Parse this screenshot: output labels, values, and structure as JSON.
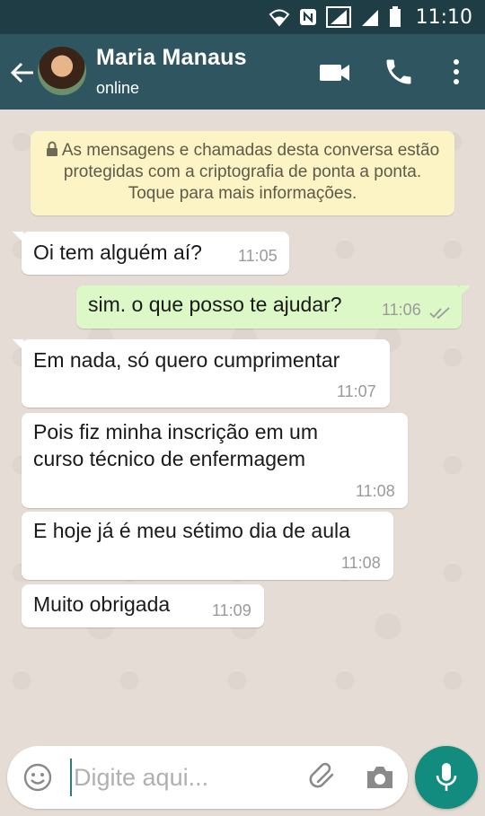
{
  "status_bar": {
    "time": "11:10",
    "icons": [
      "wifi-icon",
      "nfc-icon",
      "signal-icon",
      "signal-icon",
      "battery-icon"
    ]
  },
  "header": {
    "contact_name": "Maria Manaus",
    "contact_status": "online",
    "icons": [
      "back-arrow-icon",
      "video-call-icon",
      "phone-icon",
      "more-vert-icon"
    ]
  },
  "chat": {
    "encryption_notice": "As mensagens e chamadas desta conversa estão protegidas com a criptografia de ponta a ponta. Toque para mais informações.",
    "messages": [
      {
        "direction": "in",
        "text": "Oi tem alguém aí?",
        "time": "11:05"
      },
      {
        "direction": "out",
        "text": "sim. o que posso te ajudar?",
        "time": "11:06",
        "status": "read"
      },
      {
        "direction": "in",
        "text": "Em nada, só quero cumprimentar",
        "time": "11:07"
      },
      {
        "direction": "in",
        "text_lines": [
          "Pois fiz minha inscrição em um",
          "curso técnico de enfermagem"
        ],
        "time": "11:08"
      },
      {
        "direction": "in",
        "text": "E hoje já é meu sétimo dia de aula",
        "time": "11:08"
      },
      {
        "direction": "in",
        "text": "Muito obrigada",
        "time": "11:09"
      }
    ]
  },
  "input_bar": {
    "placeholder": "Digite aqui...",
    "value": "",
    "icons": [
      "emoji-icon",
      "attach-icon",
      "camera-icon",
      "mic-icon"
    ]
  },
  "colors": {
    "status_bar": "#1f3d45",
    "app_bar": "#2e5560",
    "chat_background": "#e5ddd5",
    "outgoing_bubble": "#dcf8c6",
    "incoming_bubble": "#ffffff",
    "notice_background": "#fcf4c4",
    "accent": "#128c7e",
    "read_ticks": "#9a9a9a"
  }
}
